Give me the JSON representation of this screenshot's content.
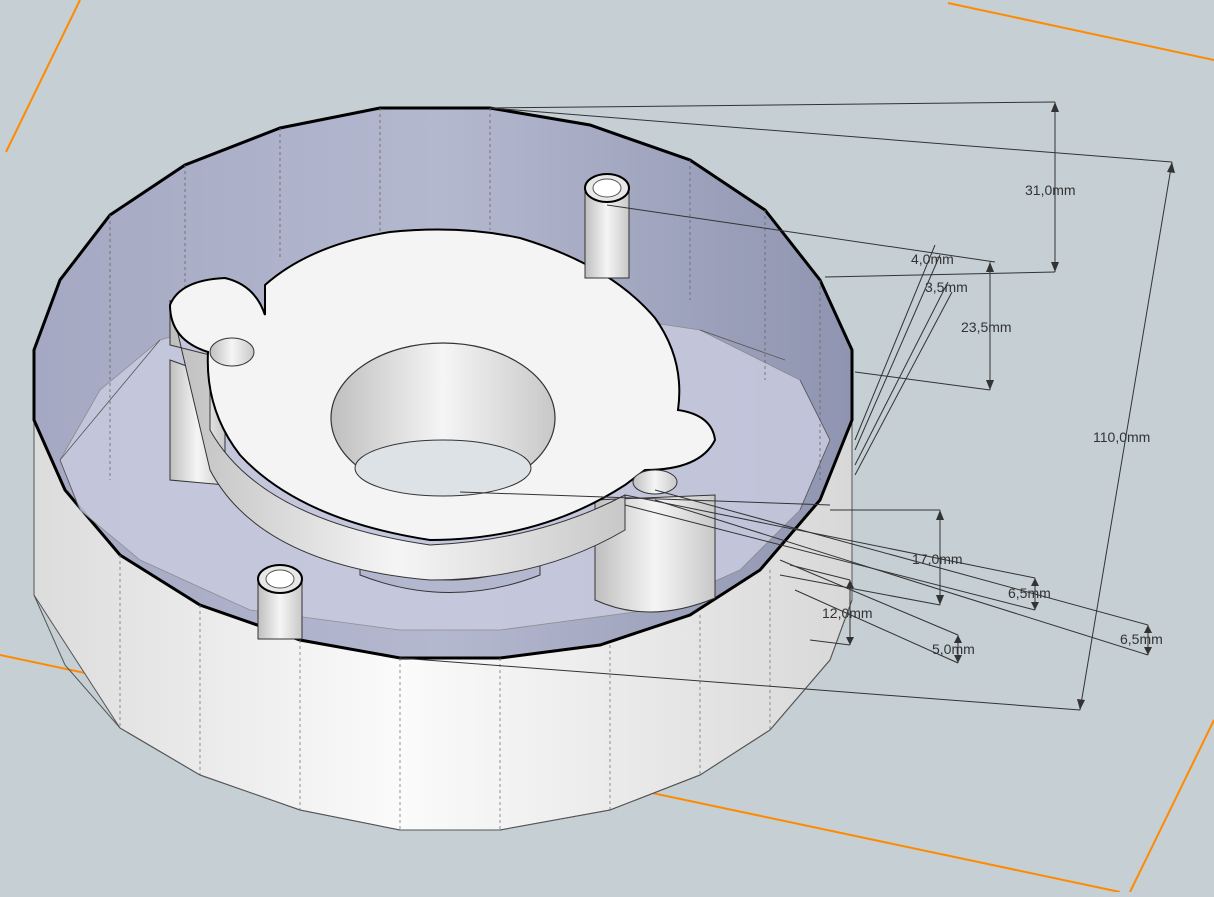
{
  "colors": {
    "background": "#c5cfd4",
    "ground_plane_edge": "#ff8a00",
    "outer_wall": "#eeeeee",
    "inner_wall": "#a9aec6",
    "floor": "#c8cade",
    "white_face": "#f4f4f4",
    "edge": "#000000",
    "dimension_line": "#333333"
  },
  "dimensions": [
    {
      "id": "dim-31",
      "label": "31,0mm"
    },
    {
      "id": "dim-4",
      "label": "4,0mm"
    },
    {
      "id": "dim-3-5",
      "label": "3,5mm"
    },
    {
      "id": "dim-23-5",
      "label": "23,5mm"
    },
    {
      "id": "dim-110",
      "label": "110,0mm"
    },
    {
      "id": "dim-17",
      "label": "17,0mm"
    },
    {
      "id": "dim-6-5-a",
      "label": "6,5mm"
    },
    {
      "id": "dim-6-5-b",
      "label": "6,5mm"
    },
    {
      "id": "dim-12",
      "label": "12,0mm"
    },
    {
      "id": "dim-5",
      "label": "5,0mm"
    }
  ]
}
